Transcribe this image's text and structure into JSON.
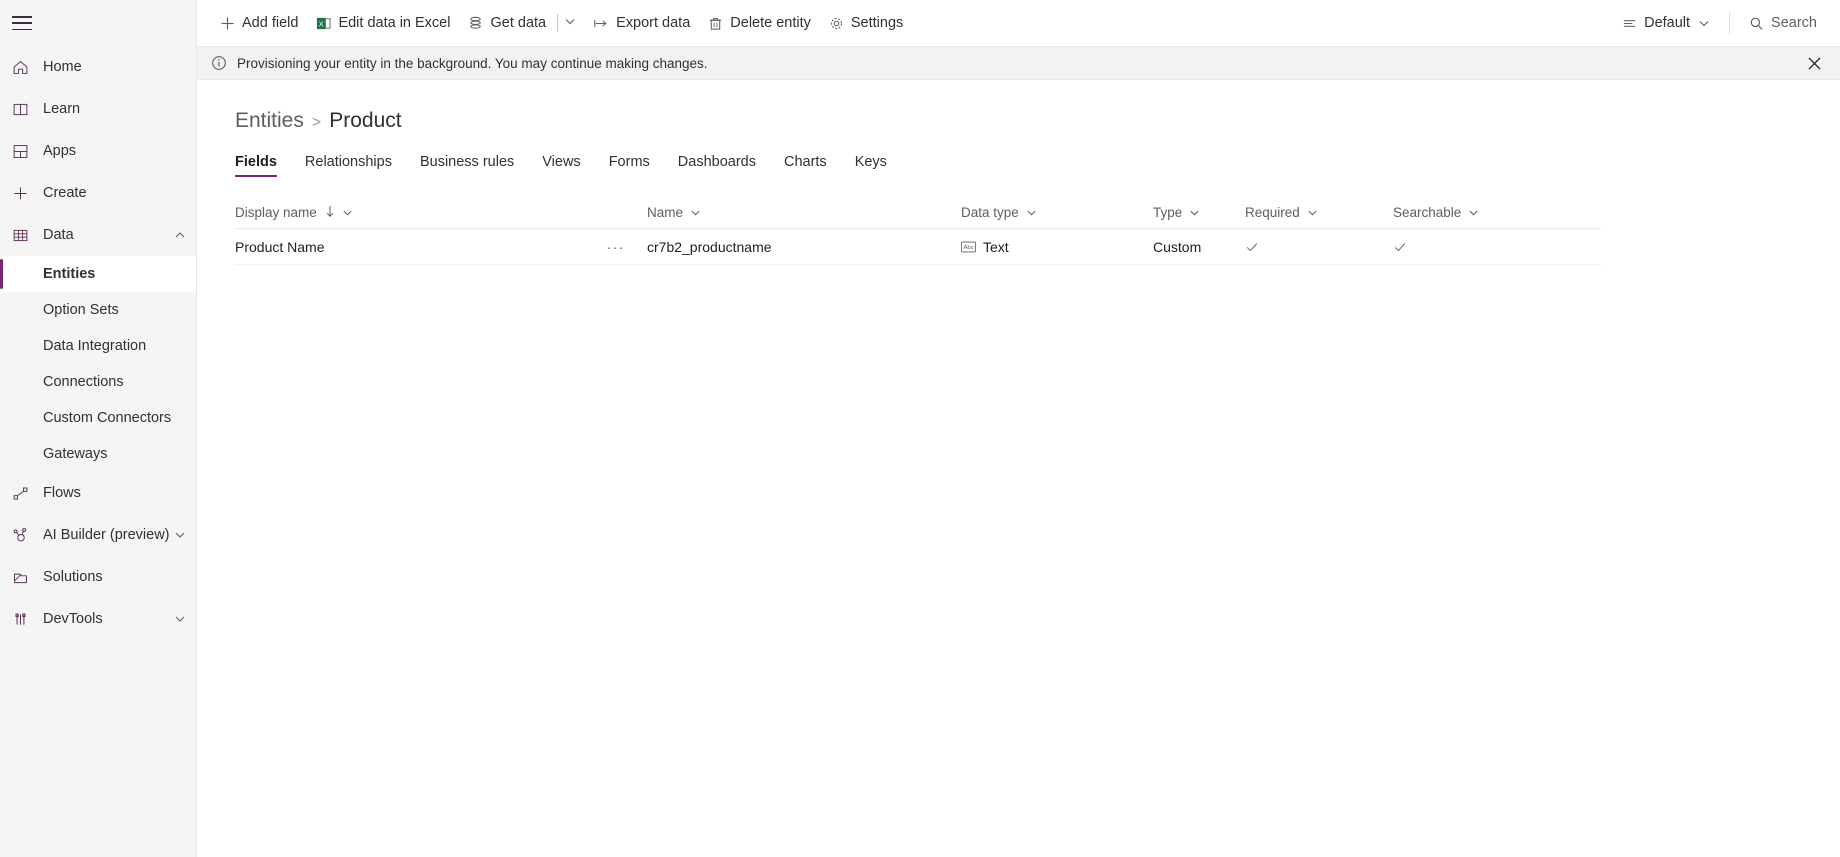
{
  "sidebar": {
    "menu_icon": "hamburger-icon",
    "items": [
      {
        "label": "Home",
        "icon": "home-icon",
        "type": "top"
      },
      {
        "label": "Learn",
        "icon": "book-icon",
        "type": "top"
      },
      {
        "label": "Apps",
        "icon": "apps-grid-icon",
        "type": "top"
      },
      {
        "label": "Create",
        "icon": "plus-icon",
        "type": "top"
      },
      {
        "label": "Data",
        "icon": "table-icon",
        "type": "top",
        "expanded": true,
        "chevron": "chevron-up-icon"
      },
      {
        "label": "Entities",
        "type": "sub",
        "selected": true
      },
      {
        "label": "Option Sets",
        "type": "sub",
        "selected": false
      },
      {
        "label": "Data Integration",
        "type": "sub",
        "selected": false
      },
      {
        "label": "Connections",
        "type": "sub",
        "selected": false
      },
      {
        "label": "Custom Connectors",
        "type": "sub",
        "selected": false
      },
      {
        "label": "Gateways",
        "type": "sub",
        "selected": false
      },
      {
        "label": "Flows",
        "icon": "flows-icon",
        "type": "top"
      },
      {
        "label": "AI Builder (preview)",
        "icon": "ai-builder-icon",
        "type": "top",
        "chevron": "chevron-down-icon"
      },
      {
        "label": "Solutions",
        "icon": "solutions-icon",
        "type": "top"
      },
      {
        "label": "DevTools",
        "icon": "devtools-icon",
        "type": "top",
        "chevron": "chevron-down-icon"
      }
    ]
  },
  "commandbar": {
    "add_field": "Add field",
    "edit_in_excel": "Edit data in Excel",
    "get_data": "Get data",
    "export_data": "Export data",
    "delete_entity": "Delete entity",
    "settings": "Settings",
    "view_selector": "Default",
    "search": "Search"
  },
  "notification": {
    "message": "Provisioning your entity in the background. You may continue making changes.",
    "icon": "info-icon",
    "close_icon": "close-icon"
  },
  "breadcrumb": {
    "parent": "Entities",
    "separator": ">",
    "current": "Product"
  },
  "tabs": [
    {
      "label": "Fields",
      "active": true
    },
    {
      "label": "Relationships",
      "active": false
    },
    {
      "label": "Business rules",
      "active": false
    },
    {
      "label": "Views",
      "active": false
    },
    {
      "label": "Forms",
      "active": false
    },
    {
      "label": "Dashboards",
      "active": false
    },
    {
      "label": "Charts",
      "active": false
    },
    {
      "label": "Keys",
      "active": false
    }
  ],
  "table": {
    "columns": [
      {
        "label": "Display name",
        "sorted": true,
        "sort_dir": "asc"
      },
      {
        "label": "Name",
        "sorted": false
      },
      {
        "label": "Data type",
        "sorted": false
      },
      {
        "label": "Type",
        "sorted": false
      },
      {
        "label": "Required",
        "sorted": false
      },
      {
        "label": "Searchable",
        "sorted": false
      }
    ],
    "rows": [
      {
        "display_name": "Product Name",
        "overflow": "···",
        "name": "cr7b2_productname",
        "data_type": "Text",
        "data_type_icon": "abc-text-icon",
        "type": "Custom",
        "required": "✓",
        "searchable": "✓"
      }
    ]
  },
  "colors": {
    "accent": "#742774",
    "sidebar_bg": "#f5f5f5",
    "notification_bg": "#f3f2f1",
    "text": "#323130",
    "muted": "#605e5c"
  }
}
